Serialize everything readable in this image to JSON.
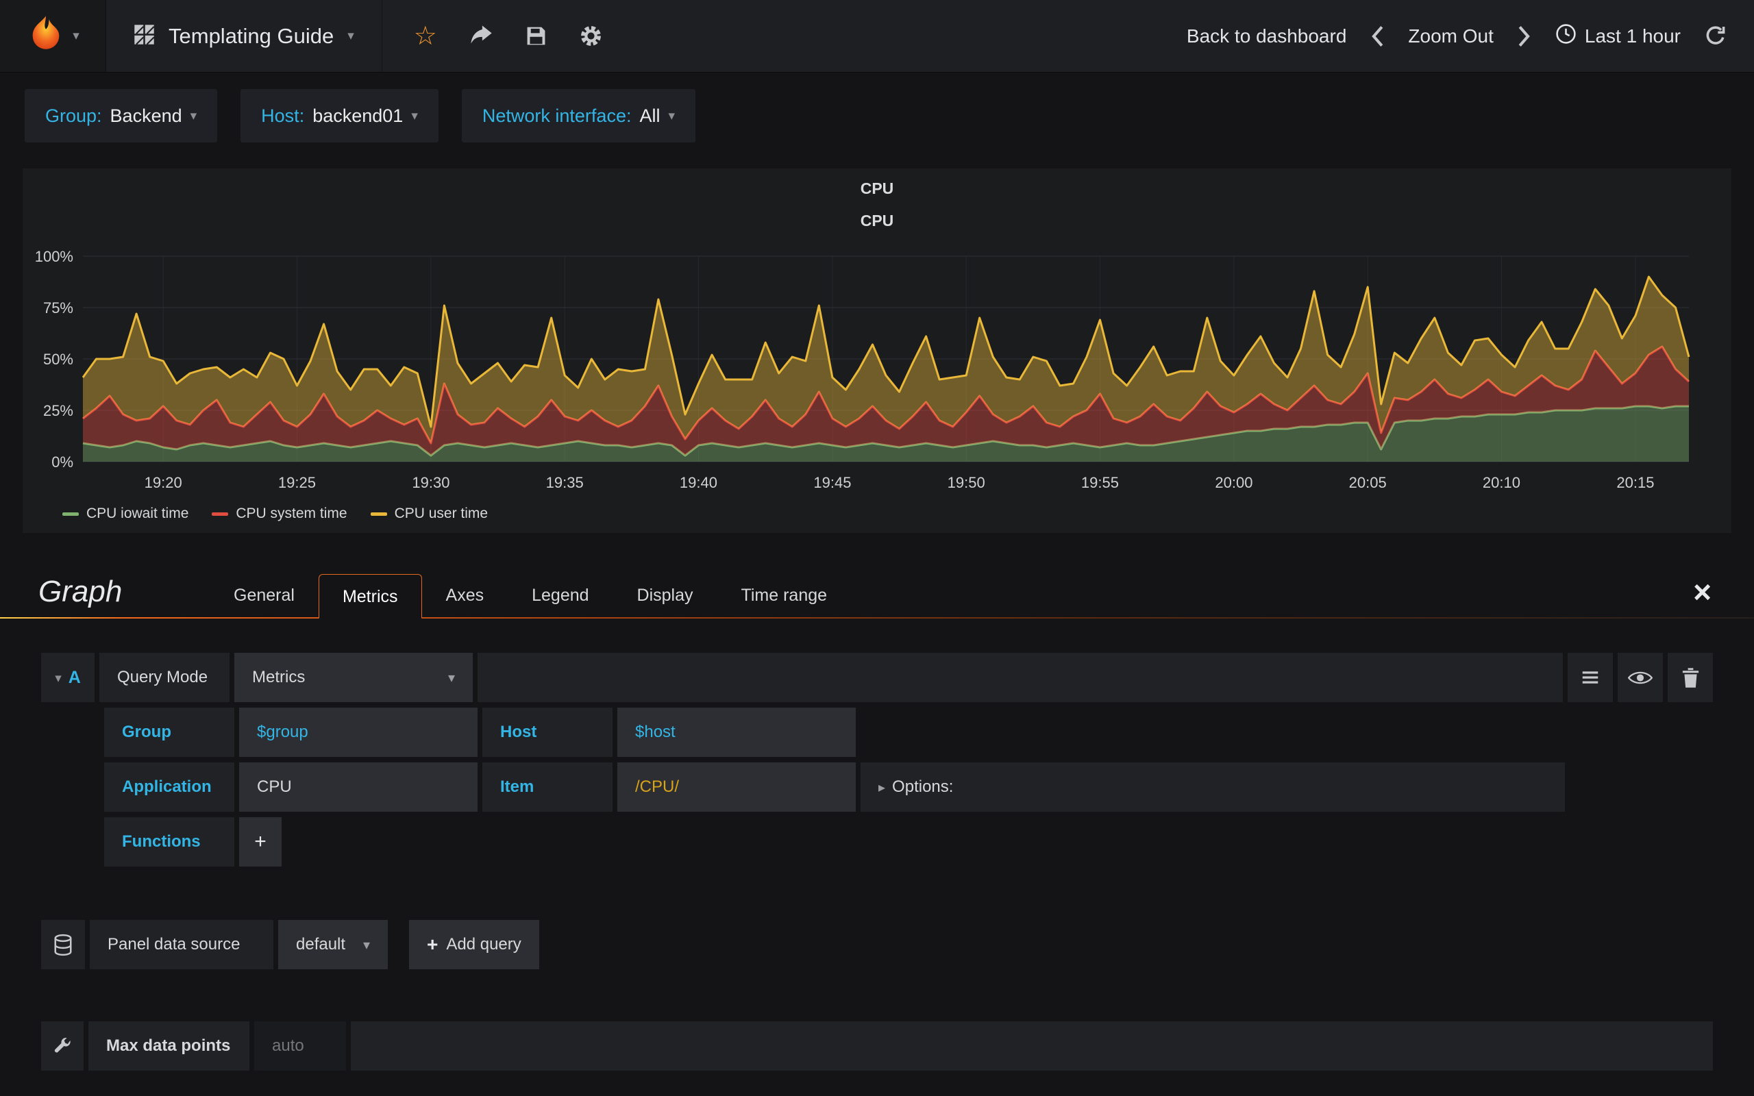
{
  "navbar": {
    "dashboard_title": "Templating Guide",
    "back_label": "Back to dashboard",
    "zoom_out_label": "Zoom Out",
    "time_range_label": "Last 1 hour"
  },
  "variables": [
    {
      "label": "Group:",
      "value": "Backend"
    },
    {
      "label": "Host:",
      "value": "backend01"
    },
    {
      "label": "Network interface:",
      "value": "All"
    }
  ],
  "panel": {
    "header": "CPU"
  },
  "chart_data": {
    "type": "area",
    "stacked": true,
    "title": "CPU",
    "ylim": [
      0,
      100
    ],
    "grid": true,
    "legend_position": "bottom-left",
    "y_ticks": [
      {
        "value": 0,
        "label": "0%"
      },
      {
        "value": 25,
        "label": "25%"
      },
      {
        "value": 50,
        "label": "50%"
      },
      {
        "value": 75,
        "label": "75%"
      },
      {
        "value": 100,
        "label": "100%"
      }
    ],
    "x_ticks": [
      {
        "fraction": 0.05,
        "label": "19:20"
      },
      {
        "fraction": 0.1333,
        "label": "19:25"
      },
      {
        "fraction": 0.2167,
        "label": "19:30"
      },
      {
        "fraction": 0.3,
        "label": "19:35"
      },
      {
        "fraction": 0.3833,
        "label": "19:40"
      },
      {
        "fraction": 0.4667,
        "label": "19:45"
      },
      {
        "fraction": 0.55,
        "label": "19:50"
      },
      {
        "fraction": 0.6333,
        "label": "19:55"
      },
      {
        "fraction": 0.7167,
        "label": "20:00"
      },
      {
        "fraction": 0.8,
        "label": "20:05"
      },
      {
        "fraction": 0.8833,
        "label": "20:10"
      },
      {
        "fraction": 0.9667,
        "label": "20:15"
      }
    ],
    "series": [
      {
        "name": "CPU iowait time",
        "color": "#7EB26D",
        "values": [
          9,
          8,
          7,
          8,
          10,
          9,
          7,
          6,
          8,
          9,
          8,
          7,
          8,
          9,
          10,
          8,
          7,
          8,
          9,
          8,
          7,
          8,
          9,
          10,
          9,
          8,
          3,
          8,
          9,
          8,
          7,
          8,
          9,
          8,
          7,
          8,
          9,
          10,
          9,
          8,
          8,
          7,
          8,
          9,
          8,
          3,
          8,
          9,
          8,
          7,
          8,
          9,
          8,
          7,
          8,
          9,
          8,
          7,
          8,
          9,
          8,
          7,
          8,
          9,
          8,
          7,
          8,
          9,
          10,
          9,
          8,
          8,
          7,
          8,
          9,
          8,
          7,
          8,
          9,
          8,
          8,
          9,
          10,
          11,
          12,
          13,
          14,
          15,
          15,
          16,
          16,
          17,
          17,
          18,
          18,
          19,
          19,
          6,
          19,
          20,
          20,
          21,
          21,
          22,
          22,
          23,
          23,
          23,
          24,
          24,
          25,
          25,
          25,
          26,
          26,
          26,
          27,
          27,
          26,
          27,
          27
        ]
      },
      {
        "name": "CPU system time",
        "color": "#E24D42",
        "values": [
          12,
          18,
          25,
          15,
          10,
          12,
          20,
          14,
          10,
          16,
          22,
          12,
          9,
          14,
          19,
          12,
          10,
          15,
          24,
          14,
          10,
          12,
          16,
          11,
          9,
          13,
          6,
          30,
          14,
          10,
          12,
          18,
          12,
          9,
          15,
          22,
          13,
          10,
          16,
          12,
          9,
          13,
          19,
          28,
          14,
          8,
          12,
          17,
          12,
          9,
          14,
          21,
          13,
          10,
          15,
          25,
          13,
          10,
          13,
          18,
          12,
          9,
          14,
          20,
          12,
          10,
          16,
          23,
          13,
          10,
          14,
          19,
          12,
          9,
          13,
          17,
          26,
          13,
          10,
          14,
          20,
          13,
          10,
          15,
          22,
          14,
          10,
          13,
          18,
          12,
          9,
          14,
          20,
          12,
          10,
          15,
          24,
          8,
          12,
          10,
          14,
          19,
          12,
          9,
          13,
          17,
          11,
          9,
          13,
          18,
          12,
          10,
          15,
          28,
          20,
          12,
          16,
          25,
          30,
          18,
          12
        ]
      },
      {
        "name": "CPU user time",
        "color": "#EAB839",
        "values": [
          20,
          24,
          18,
          28,
          52,
          30,
          22,
          18,
          25,
          20,
          16,
          22,
          28,
          18,
          24,
          30,
          20,
          26,
          34,
          22,
          18,
          25,
          20,
          16,
          28,
          22,
          8,
          38,
          25,
          20,
          24,
          22,
          18,
          30,
          24,
          40,
          20,
          16,
          25,
          20,
          28,
          24,
          18,
          42,
          30,
          12,
          18,
          26,
          20,
          24,
          18,
          28,
          22,
          34,
          26,
          42,
          20,
          18,
          24,
          30,
          22,
          18,
          26,
          32,
          20,
          24,
          18,
          38,
          28,
          22,
          18,
          24,
          30,
          20,
          16,
          26,
          36,
          22,
          18,
          24,
          28,
          20,
          24,
          18,
          36,
          22,
          18,
          24,
          28,
          20,
          16,
          24,
          46,
          22,
          18,
          28,
          42,
          14,
          22,
          18,
          26,
          30,
          20,
          16,
          24,
          20,
          18,
          14,
          22,
          26,
          18,
          20,
          28,
          30,
          30,
          22,
          28,
          38,
          25,
          30,
          12
        ]
      }
    ]
  },
  "editor": {
    "title": "Graph",
    "tabs": [
      "General",
      "Metrics",
      "Axes",
      "Legend",
      "Display",
      "Time range"
    ],
    "active_tab": "Metrics",
    "query": {
      "letter": "A",
      "query_mode_label": "Query Mode",
      "query_mode_value": "Metrics",
      "group_label": "Group",
      "group_value": "$group",
      "host_label": "Host",
      "host_value": "$host",
      "application_label": "Application",
      "application_value": "CPU",
      "item_label": "Item",
      "item_value": "/CPU/",
      "options_label": "Options:",
      "functions_label": "Functions"
    },
    "datasource": {
      "label": "Panel data source",
      "value": "default",
      "add_query_label": "Add query"
    },
    "max_data_points": {
      "label": "Max data points",
      "value": "auto"
    }
  },
  "colors": {
    "accent": "#33b5e5",
    "brand_orange": "#eb7b18",
    "item_value_text": "#d6a319"
  }
}
